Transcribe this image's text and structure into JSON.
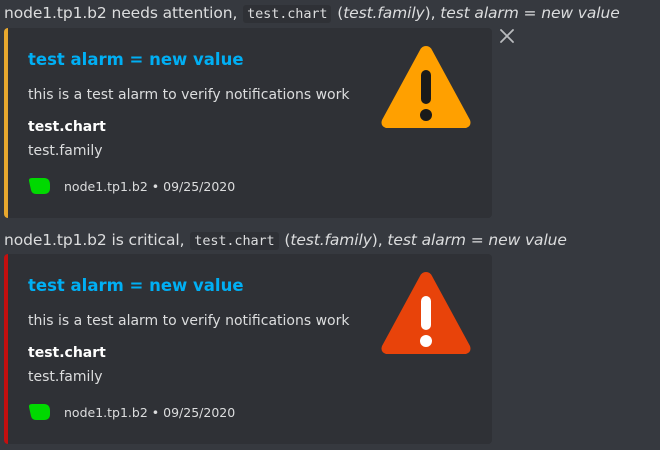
{
  "messages": [
    {
      "content": {
        "host": "node1.tp1.b2",
        "status_text": "needs attention,",
        "chart_code": "test.chart",
        "family": "test.family",
        "alarm_text": "test alarm = new value"
      },
      "embed": {
        "accent_color": "#e8a82e",
        "title": "test alarm = new value",
        "description": "this is a test alarm to verify notifications work",
        "field_name": "test.chart",
        "field_value": "test.family",
        "footer_host": "node1.tp1.b2",
        "footer_separator": "•",
        "footer_date": "09/25/2020",
        "thumbnail_icon": "warning-triangle-icon",
        "thumbnail_color": "#ffa000"
      }
    },
    {
      "content": {
        "host": "node1.tp1.b2",
        "status_text": "is critical,",
        "chart_code": "test.chart",
        "family": "test.family",
        "alarm_text": "test alarm = new value"
      },
      "embed": {
        "accent_color": "#c40f0f",
        "title": "test alarm = new value",
        "description": "this is a test alarm to verify notifications work",
        "field_name": "test.chart",
        "field_value": "test.family",
        "footer_host": "node1.tp1.b2",
        "footer_separator": "•",
        "footer_date": "09/25/2020",
        "thumbnail_icon": "warning-triangle-icon",
        "thumbnail_color": "#e8430a"
      }
    }
  ],
  "close_icon": "close-icon",
  "footer_icon": "netdata-logo-icon",
  "colors": {
    "background": "#36393f",
    "embed_background": "#2f3136",
    "title_link": "#00aff4",
    "footer_logo": "#00d900"
  }
}
